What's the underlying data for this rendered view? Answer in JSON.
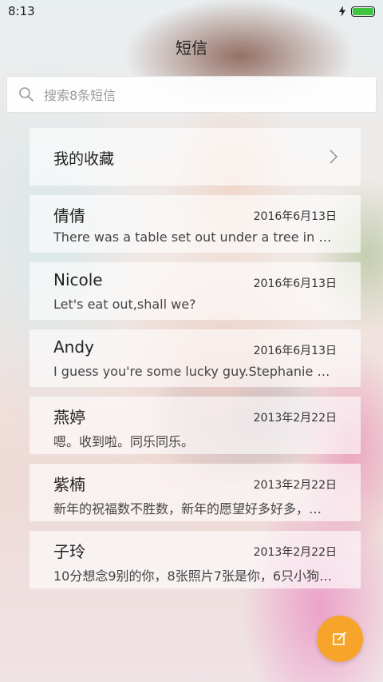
{
  "status_bar": {
    "time": "8:13",
    "battery_level": 1.0,
    "battery_color": "#3ec43e"
  },
  "header": {
    "title": "短信"
  },
  "search": {
    "placeholder": "搜索8条短信"
  },
  "favorites": {
    "label": "我的收藏"
  },
  "messages": [
    {
      "name": "倩倩",
      "date": "2016年6月13日",
      "preview": "There was a table set out under a tree in front..."
    },
    {
      "name": "Nicole",
      "date": "2016年6月13日",
      "preview": "Let's eat out,shall we?"
    },
    {
      "name": "Andy",
      "date": "2016年6月13日",
      "preview": "I guess you're some lucky guy.Stephanie is a..."
    },
    {
      "name": "燕婷",
      "date": "2013年2月22日",
      "preview": "嗯。收到啦。同乐同乐。"
    },
    {
      "name": "紫楠",
      "date": "2013年2月22日",
      "preview": "新年的祝福数不胜数，新年的愿望好多好多，新..."
    },
    {
      "name": "子玲",
      "date": "2013年2月22日",
      "preview": "10分想念9别的你，8张照片7张是你，6只小狗5只..."
    }
  ],
  "fab": {
    "icon": "compose-icon",
    "color": "#f6a52a"
  }
}
